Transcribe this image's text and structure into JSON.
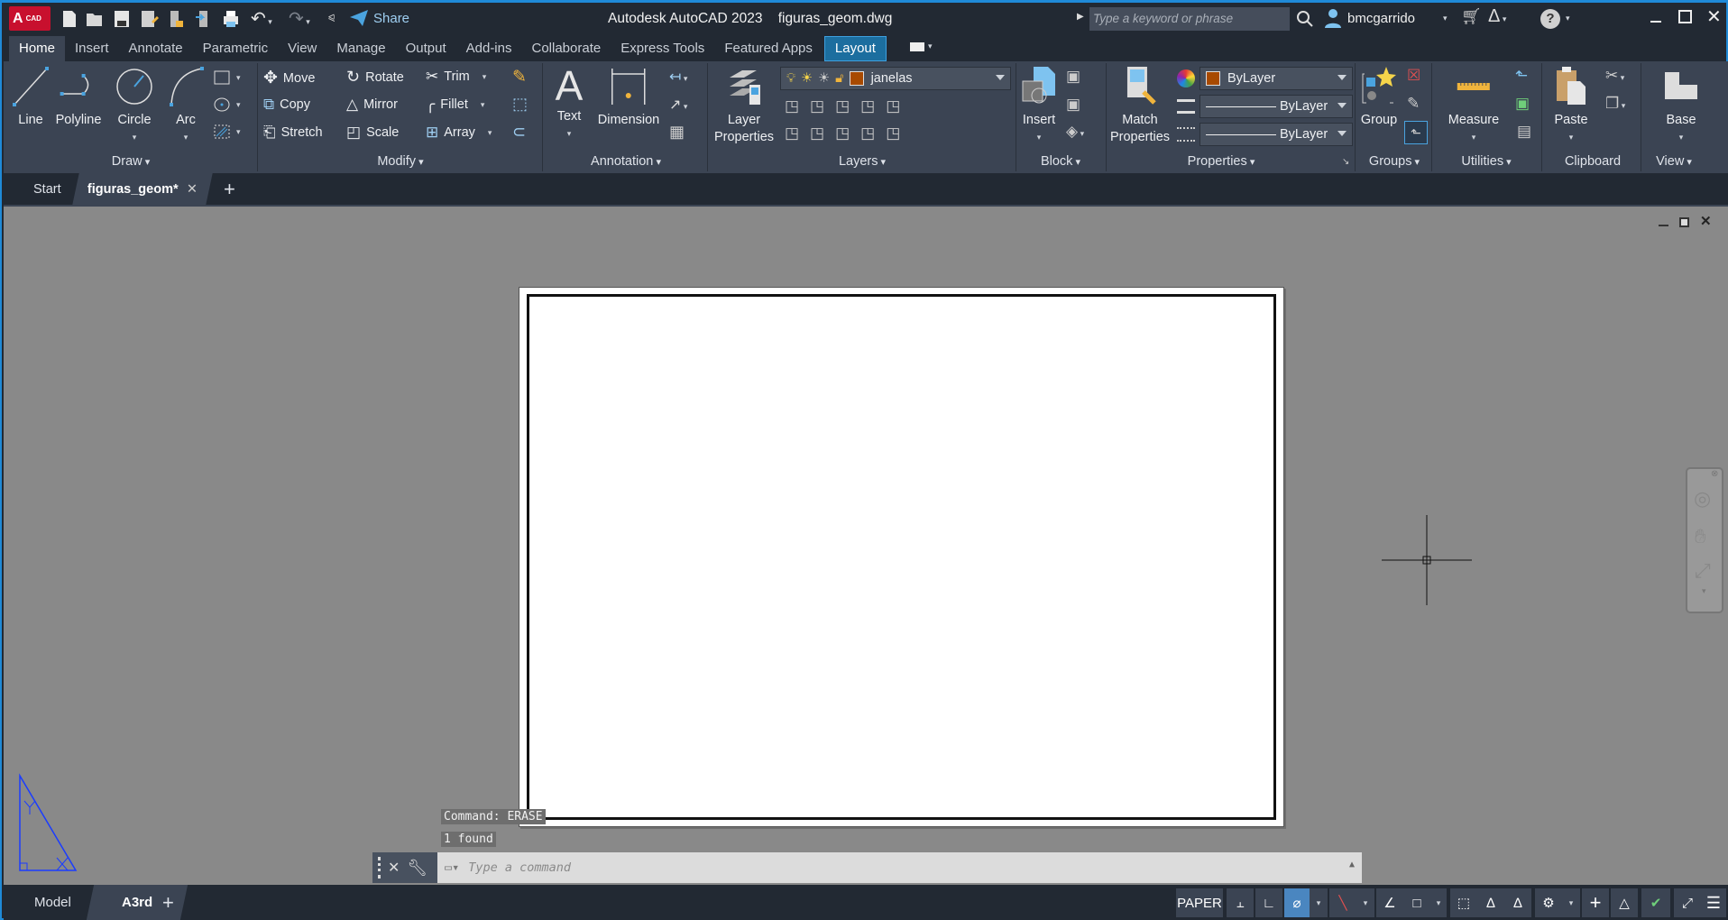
{
  "titlebar": {
    "app_badge": "CAD",
    "share_label": "Share",
    "app_title": "Autodesk AutoCAD 2023",
    "file_title": "figuras_geom.dwg",
    "search_placeholder": "Type a keyword or phrase",
    "username": "bmcgarrido"
  },
  "ribbon_tabs": [
    "Home",
    "Insert",
    "Annotate",
    "Parametric",
    "View",
    "Manage",
    "Output",
    "Add-ins",
    "Collaborate",
    "Express Tools",
    "Featured Apps",
    "Layout"
  ],
  "ribbon": {
    "draw": {
      "title": "Draw",
      "line": "Line",
      "polyline": "Polyline",
      "circle": "Circle",
      "arc": "Arc"
    },
    "modify": {
      "title": "Modify",
      "move": "Move",
      "rotate": "Rotate",
      "trim": "Trim",
      "copy": "Copy",
      "mirror": "Mirror",
      "fillet": "Fillet",
      "stretch": "Stretch",
      "scale": "Scale",
      "array": "Array"
    },
    "annotation": {
      "title": "Annotation",
      "text": "Text",
      "dimension": "Dimension"
    },
    "layers": {
      "title": "Layers",
      "layer_properties_1": "Layer",
      "layer_properties_2": "Properties",
      "current_layer": "janelas"
    },
    "block": {
      "title": "Block",
      "insert": "Insert"
    },
    "properties": {
      "title": "Properties",
      "match_1": "Match",
      "match_2": "Properties",
      "color": "ByLayer",
      "linetype": "ByLayer",
      "lineweight": "ByLayer"
    },
    "groups": {
      "title": "Groups",
      "group": "Group"
    },
    "utilities": {
      "title": "Utilities",
      "measure": "Measure"
    },
    "clipboard": {
      "title": "Clipboard",
      "paste": "Paste"
    },
    "view": {
      "title": "View",
      "base": "Base"
    }
  },
  "file_tabs": {
    "start": "Start",
    "current": "figuras_geom*"
  },
  "command": {
    "history": [
      "Command: ERASE",
      "1 found"
    ],
    "placeholder": "Type a command"
  },
  "layout_tabs": {
    "model": "Model",
    "current": "A3rd"
  },
  "statusbar": {
    "paper": "PAPER"
  },
  "colors": {
    "accent": "#1c6e9f",
    "layer_color": "#a84a00",
    "ucs": "#1a3cff"
  }
}
